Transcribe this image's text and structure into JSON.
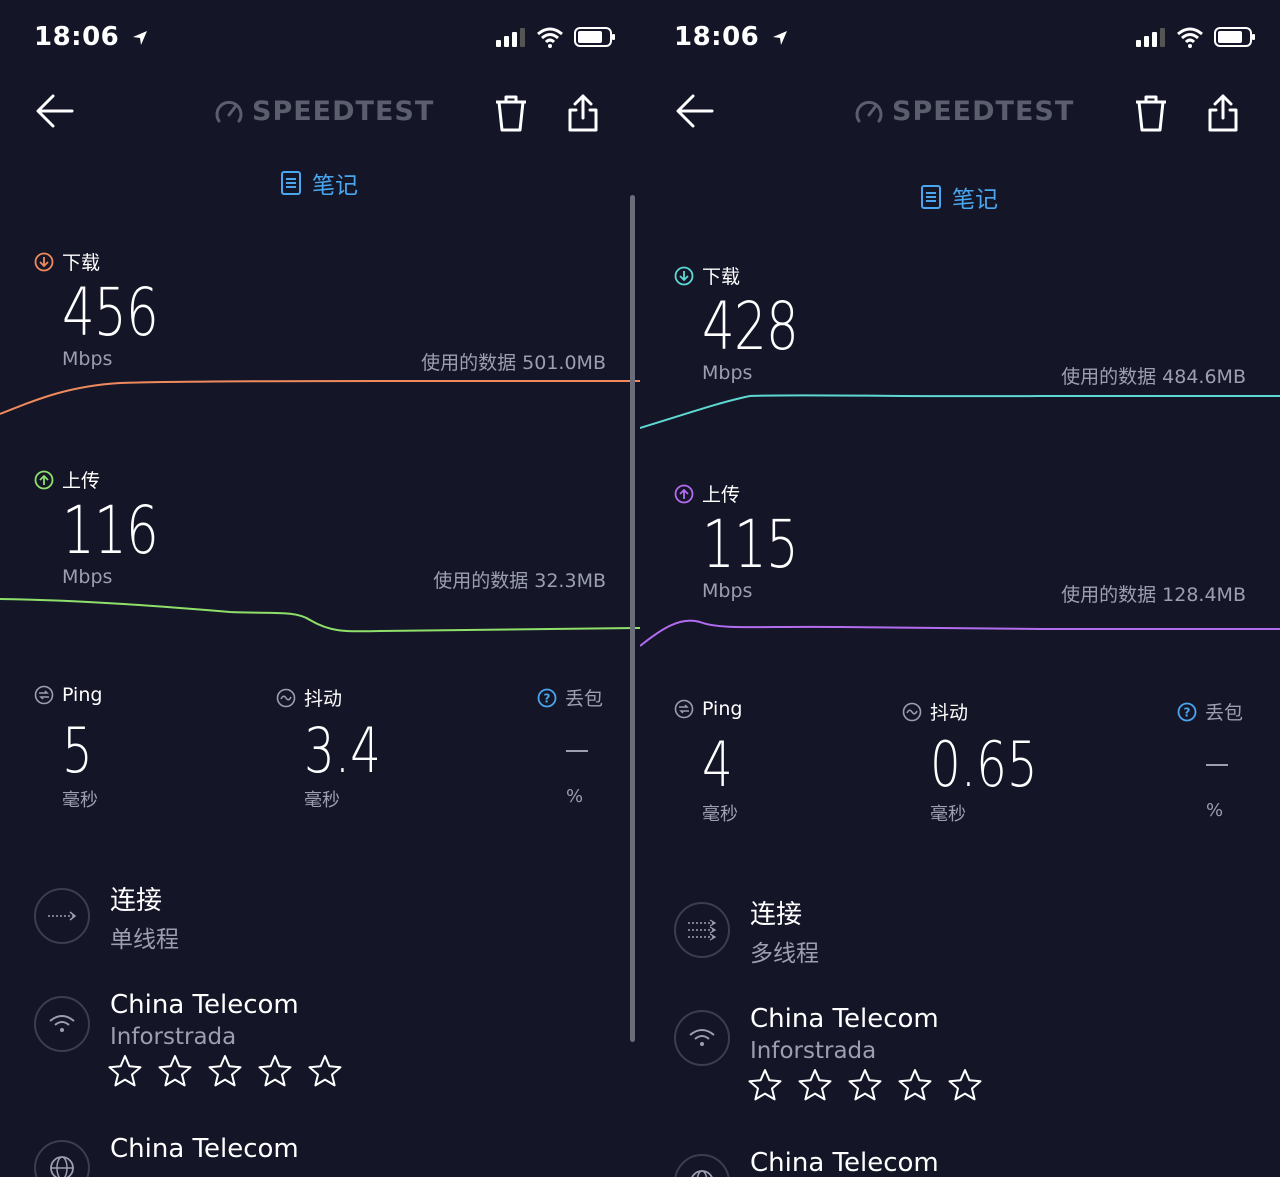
{
  "app": {
    "logo_text": "SPEEDTEST",
    "notes_label": "笔记"
  },
  "left": {
    "time": "18:06",
    "download": {
      "label": "下载",
      "value": "456",
      "unit": "Mbps",
      "data_used": "使用的数据 501.0MB",
      "color": "#f08a5d"
    },
    "upload": {
      "label": "上传",
      "value": "116",
      "unit": "Mbps",
      "data_used": "使用的数据 32.3MB",
      "color": "#8ee06a"
    },
    "ping": {
      "label": "Ping",
      "value": "5",
      "unit": "毫秒"
    },
    "jitter": {
      "label": "抖动",
      "value": "3.4",
      "unit": "毫秒"
    },
    "loss": {
      "label": "丢包",
      "unit": "%"
    },
    "connection": {
      "title": "连接",
      "value": "单线程"
    },
    "provider": {
      "name": "China Telecom",
      "sub": "Inforstrada",
      "rating_stars": 5
    },
    "server": {
      "name": "China Telecom"
    }
  },
  "right": {
    "time": "18:06",
    "download": {
      "label": "下载",
      "value": "428",
      "unit": "Mbps",
      "data_used": "使用的数据 484.6MB",
      "color": "#5fd8d2"
    },
    "upload": {
      "label": "上传",
      "value": "115",
      "unit": "Mbps",
      "data_used": "使用的数据 128.4MB",
      "color": "#b26cf0"
    },
    "ping": {
      "label": "Ping",
      "value": "4",
      "unit": "毫秒"
    },
    "jitter": {
      "label": "抖动",
      "value": "0.65",
      "unit": "毫秒"
    },
    "loss": {
      "label": "丢包",
      "unit": "%"
    },
    "connection": {
      "title": "连接",
      "value": "多线程"
    },
    "provider": {
      "name": "China Telecom",
      "sub": "Inforstrada",
      "rating_stars": 5
    },
    "server": {
      "name": "China Telecom"
    }
  },
  "colors": {
    "background": "#141628",
    "accent_blue": "#4aa6ef",
    "muted_text": "#9c9fad"
  },
  "icons": [
    "back-arrow-icon",
    "speedometer-icon",
    "trash-icon",
    "share-icon",
    "notes-icon",
    "download-icon",
    "upload-icon",
    "ping-icon",
    "jitter-icon",
    "help-icon",
    "connection-icon",
    "wifi-icon",
    "globe-icon",
    "star-icon"
  ]
}
